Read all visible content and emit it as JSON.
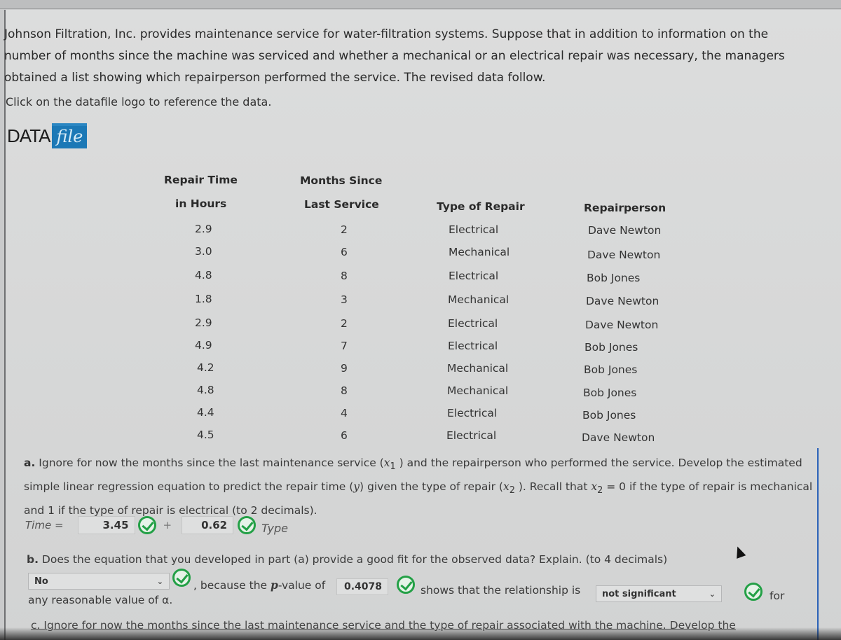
{
  "intro": {
    "paragraph": "Johnson Filtration, Inc. provides maintenance service for water-filtration systems. Suppose that in addition to information on the number of months since the machine was serviced and whether a mechanical or an electrical repair was necessary, the managers obtained a list showing which repairperson performed the service. The revised data follow.",
    "click_note": "Click on the datafile logo to reference the data.",
    "datafile_logo": {
      "data_text": "DATA",
      "file_text": "file"
    }
  },
  "table": {
    "headers": {
      "repair_time_line1": "Repair Time",
      "repair_time_line2": "in Hours",
      "months_line1": "Months Since",
      "months_line2": "Last Service",
      "type": "Type of Repair",
      "person": "Repairperson"
    },
    "rows": [
      {
        "hours": "2.9",
        "months": "2",
        "type": "Electrical",
        "person": "Dave Newton"
      },
      {
        "hours": "3.0",
        "months": "6",
        "type": "Mechanical",
        "person": "Dave Newton"
      },
      {
        "hours": "4.8",
        "months": "8",
        "type": "Electrical",
        "person": "Bob Jones"
      },
      {
        "hours": "1.8",
        "months": "3",
        "type": "Mechanical",
        "person": "Dave Newton"
      },
      {
        "hours": "2.9",
        "months": "2",
        "type": "Electrical",
        "person": "Dave Newton"
      },
      {
        "hours": "4.9",
        "months": "7",
        "type": "Electrical",
        "person": "Bob Jones"
      },
      {
        "hours": "4.2",
        "months": "9",
        "type": "Mechanical",
        "person": "Bob Jones"
      },
      {
        "hours": "4.8",
        "months": "8",
        "type": "Mechanical",
        "person": "Bob Jones"
      },
      {
        "hours": "4.4",
        "months": "4",
        "type": "Electrical",
        "person": "Bob Jones"
      },
      {
        "hours": "4.5",
        "months": "6",
        "type": "Electrical",
        "person": "Dave Newton"
      }
    ]
  },
  "part_a": {
    "label": "a.",
    "text1": " Ignore for now the months since the last maintenance service (",
    "x1": "x",
    "x1_sub": "1",
    "text2": " ) and the repairperson who performed the service. Develop the estimated simple linear regression equation to predict the repair time (",
    "y": "y",
    "text3": ") given the type of repair (",
    "x2": "x",
    "x2_sub": "2",
    "text4": " ). Recall that ",
    "x2b": "x",
    "x2b_sub": "2",
    "text5": " = 0 if the type of repair is mechanical and 1 if the type of repair is electrical (to 2 decimals).",
    "eq_label": "Time =",
    "intercept": "3.45",
    "plus": "+",
    "slope": "0.62",
    "var_label": "Type"
  },
  "part_b": {
    "label": "b.",
    "question": " Does the equation that you developed in part (a) provide a good fit for the observed data? Explain. (to 4 decimals)",
    "fit_select": "No",
    "because_text": ", because the ",
    "p": "p",
    "pvalue_text": "-value of",
    "pvalue": "0.4078",
    "shows_text": "shows that the relationship is",
    "significance_select": "not significant",
    "for_text": "for",
    "alpha_text": "any reasonable value of α."
  },
  "part_c": {
    "text": "c. Ignore for now the months since the last maintenance service and the type of repair associated with the machine. Develop the"
  }
}
